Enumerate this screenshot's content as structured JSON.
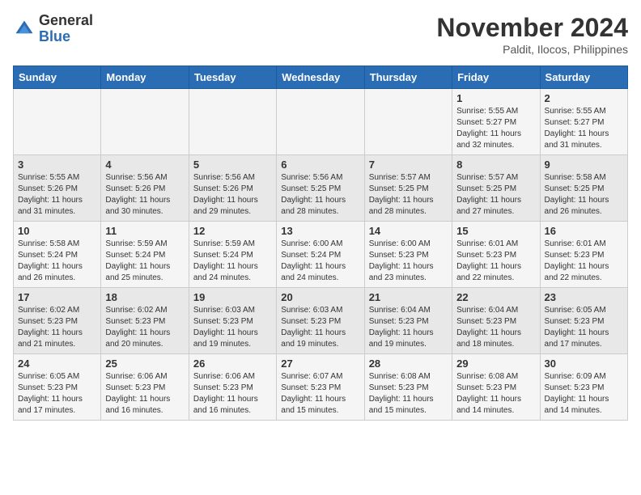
{
  "logo": {
    "general": "General",
    "blue": "Blue"
  },
  "title": "November 2024",
  "subtitle": "Paldit, Ilocos, Philippines",
  "days_of_week": [
    "Sunday",
    "Monday",
    "Tuesday",
    "Wednesday",
    "Thursday",
    "Friday",
    "Saturday"
  ],
  "weeks": [
    [
      {
        "day": "",
        "info": ""
      },
      {
        "day": "",
        "info": ""
      },
      {
        "day": "",
        "info": ""
      },
      {
        "day": "",
        "info": ""
      },
      {
        "day": "",
        "info": ""
      },
      {
        "day": "1",
        "info": "Sunrise: 5:55 AM\nSunset: 5:27 PM\nDaylight: 11 hours and 32 minutes."
      },
      {
        "day": "2",
        "info": "Sunrise: 5:55 AM\nSunset: 5:27 PM\nDaylight: 11 hours and 31 minutes."
      }
    ],
    [
      {
        "day": "3",
        "info": "Sunrise: 5:55 AM\nSunset: 5:26 PM\nDaylight: 11 hours and 31 minutes."
      },
      {
        "day": "4",
        "info": "Sunrise: 5:56 AM\nSunset: 5:26 PM\nDaylight: 11 hours and 30 minutes."
      },
      {
        "day": "5",
        "info": "Sunrise: 5:56 AM\nSunset: 5:26 PM\nDaylight: 11 hours and 29 minutes."
      },
      {
        "day": "6",
        "info": "Sunrise: 5:56 AM\nSunset: 5:25 PM\nDaylight: 11 hours and 28 minutes."
      },
      {
        "day": "7",
        "info": "Sunrise: 5:57 AM\nSunset: 5:25 PM\nDaylight: 11 hours and 28 minutes."
      },
      {
        "day": "8",
        "info": "Sunrise: 5:57 AM\nSunset: 5:25 PM\nDaylight: 11 hours and 27 minutes."
      },
      {
        "day": "9",
        "info": "Sunrise: 5:58 AM\nSunset: 5:25 PM\nDaylight: 11 hours and 26 minutes."
      }
    ],
    [
      {
        "day": "10",
        "info": "Sunrise: 5:58 AM\nSunset: 5:24 PM\nDaylight: 11 hours and 26 minutes."
      },
      {
        "day": "11",
        "info": "Sunrise: 5:59 AM\nSunset: 5:24 PM\nDaylight: 11 hours and 25 minutes."
      },
      {
        "day": "12",
        "info": "Sunrise: 5:59 AM\nSunset: 5:24 PM\nDaylight: 11 hours and 24 minutes."
      },
      {
        "day": "13",
        "info": "Sunrise: 6:00 AM\nSunset: 5:24 PM\nDaylight: 11 hours and 24 minutes."
      },
      {
        "day": "14",
        "info": "Sunrise: 6:00 AM\nSunset: 5:23 PM\nDaylight: 11 hours and 23 minutes."
      },
      {
        "day": "15",
        "info": "Sunrise: 6:01 AM\nSunset: 5:23 PM\nDaylight: 11 hours and 22 minutes."
      },
      {
        "day": "16",
        "info": "Sunrise: 6:01 AM\nSunset: 5:23 PM\nDaylight: 11 hours and 22 minutes."
      }
    ],
    [
      {
        "day": "17",
        "info": "Sunrise: 6:02 AM\nSunset: 5:23 PM\nDaylight: 11 hours and 21 minutes."
      },
      {
        "day": "18",
        "info": "Sunrise: 6:02 AM\nSunset: 5:23 PM\nDaylight: 11 hours and 20 minutes."
      },
      {
        "day": "19",
        "info": "Sunrise: 6:03 AM\nSunset: 5:23 PM\nDaylight: 11 hours and 19 minutes."
      },
      {
        "day": "20",
        "info": "Sunrise: 6:03 AM\nSunset: 5:23 PM\nDaylight: 11 hours and 19 minutes."
      },
      {
        "day": "21",
        "info": "Sunrise: 6:04 AM\nSunset: 5:23 PM\nDaylight: 11 hours and 19 minutes."
      },
      {
        "day": "22",
        "info": "Sunrise: 6:04 AM\nSunset: 5:23 PM\nDaylight: 11 hours and 18 minutes."
      },
      {
        "day": "23",
        "info": "Sunrise: 6:05 AM\nSunset: 5:23 PM\nDaylight: 11 hours and 17 minutes."
      }
    ],
    [
      {
        "day": "24",
        "info": "Sunrise: 6:05 AM\nSunset: 5:23 PM\nDaylight: 11 hours and 17 minutes."
      },
      {
        "day": "25",
        "info": "Sunrise: 6:06 AM\nSunset: 5:23 PM\nDaylight: 11 hours and 16 minutes."
      },
      {
        "day": "26",
        "info": "Sunrise: 6:06 AM\nSunset: 5:23 PM\nDaylight: 11 hours and 16 minutes."
      },
      {
        "day": "27",
        "info": "Sunrise: 6:07 AM\nSunset: 5:23 PM\nDaylight: 11 hours and 15 minutes."
      },
      {
        "day": "28",
        "info": "Sunrise: 6:08 AM\nSunset: 5:23 PM\nDaylight: 11 hours and 15 minutes."
      },
      {
        "day": "29",
        "info": "Sunrise: 6:08 AM\nSunset: 5:23 PM\nDaylight: 11 hours and 14 minutes."
      },
      {
        "day": "30",
        "info": "Sunrise: 6:09 AM\nSunset: 5:23 PM\nDaylight: 11 hours and 14 minutes."
      }
    ]
  ]
}
